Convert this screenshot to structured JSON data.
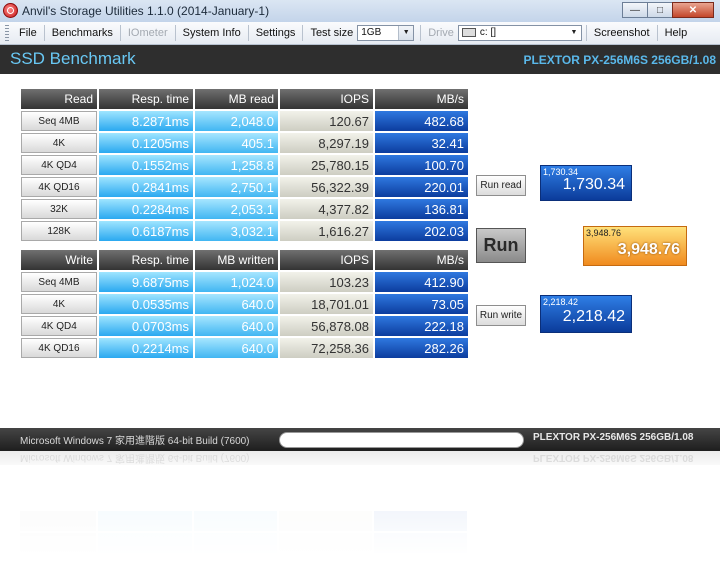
{
  "window": {
    "title": "Anvil's Storage Utilities 1.1.0 (2014-January-1)",
    "controls": {
      "minimize": "—",
      "maximize": "□",
      "close": "✕"
    }
  },
  "menu": {
    "file": "File",
    "benchmarks": "Benchmarks",
    "iometer": "IOmeter",
    "system_info": "System Info",
    "settings": "Settings",
    "test_size_label": "Test size",
    "test_size_value": "1GB",
    "drive_label": "Drive",
    "drive_value": "c: []",
    "screenshot": "Screenshot",
    "help": "Help"
  },
  "header": {
    "title": "SSD Benchmark",
    "device": "PLEXTOR PX-256M6S 256GB/1.08"
  },
  "read_table": {
    "headers": [
      "Read",
      "Resp. time",
      "MB read",
      "IOPS",
      "MB/s"
    ],
    "rows": [
      {
        "label": "Seq 4MB",
        "resp": "8.2871ms",
        "mb": "2,048.0",
        "iops": "120.67",
        "mbs": "482.68"
      },
      {
        "label": "4K",
        "resp": "0.1205ms",
        "mb": "405.1",
        "iops": "8,297.19",
        "mbs": "32.41"
      },
      {
        "label": "4K QD4",
        "resp": "0.1552ms",
        "mb": "1,258.8",
        "iops": "25,780.15",
        "mbs": "100.70"
      },
      {
        "label": "4K QD16",
        "resp": "0.2841ms",
        "mb": "2,750.1",
        "iops": "56,322.39",
        "mbs": "220.01"
      },
      {
        "label": "32K",
        "resp": "0.2284ms",
        "mb": "2,053.1",
        "iops": "4,377.82",
        "mbs": "136.81"
      },
      {
        "label": "128K",
        "resp": "0.6187ms",
        "mb": "3,032.1",
        "iops": "1,616.27",
        "mbs": "202.03"
      }
    ]
  },
  "write_table": {
    "headers": [
      "Write",
      "Resp. time",
      "MB written",
      "IOPS",
      "MB/s"
    ],
    "rows": [
      {
        "label": "Seq 4MB",
        "resp": "9.6875ms",
        "mb": "1,024.0",
        "iops": "103.23",
        "mbs": "412.90"
      },
      {
        "label": "4K",
        "resp": "0.0535ms",
        "mb": "640.0",
        "iops": "18,701.01",
        "mbs": "73.05"
      },
      {
        "label": "4K QD4",
        "resp": "0.0703ms",
        "mb": "640.0",
        "iops": "56,878.08",
        "mbs": "222.18"
      },
      {
        "label": "4K QD16",
        "resp": "0.2214ms",
        "mb": "640.0",
        "iops": "72,258.36",
        "mbs": "282.26"
      }
    ]
  },
  "buttons": {
    "run_read": "Run read",
    "run": "Run",
    "run_write": "Run write"
  },
  "scores": {
    "read_small": "1,730.34",
    "read_big": "1,730.34",
    "total_small": "3,948.76",
    "total_big": "3,948.76",
    "write_small": "2,218.42",
    "write_big": "2,218.42"
  },
  "status": {
    "os": "Microsoft Windows 7 家用進階版  64-bit Build (7600)",
    "device": "PLEXTOR PX-256M6S 256GB/1.08"
  },
  "colors": {
    "header_text": "#69c8f4",
    "mbs_cell": "#0c3c9e",
    "resp_cell": "#2aa8f0",
    "total_score": "#f08a1e"
  }
}
